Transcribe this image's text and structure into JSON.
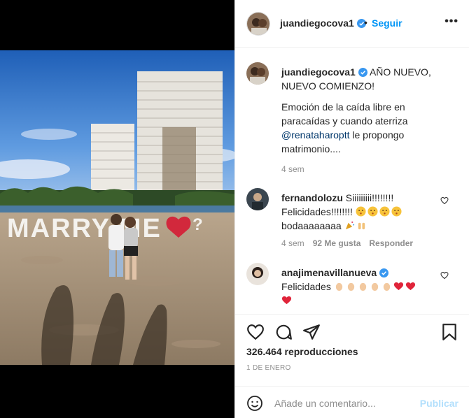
{
  "post": {
    "author": "juandiegocova1",
    "follow_label": "Seguir",
    "separator": "•",
    "more_label": "•••"
  },
  "photo": {
    "sign_text": "MARRY ME",
    "sign_question": "?"
  },
  "caption": {
    "username": "juandiegocova1",
    "headline": "AÑO NUEVO, NUEVO COMIENZO!",
    "body_before": "Emoción de la caída libre en paracaídas y cuando aterriza ",
    "mention": "@renataharoptt",
    "body_after": " le propongo matrimonio....",
    "time": "4 sem"
  },
  "comments": [
    {
      "username": "fernandolozu",
      "text_line1": "Siiiiiiiii!!!!!!!!",
      "text_line2": "Felicidades!!!!!!!!",
      "text_line3": "bodaaaaaaaa",
      "time": "4 sem",
      "likes": "92 Me gusta",
      "reply": "Responder"
    },
    {
      "username": "anajimenavillanueva",
      "text": "Felicidades"
    }
  ],
  "stats": {
    "views": "326.464 reproducciones",
    "date": "1 DE ENERO"
  },
  "composer": {
    "placeholder": "Añade un comentario...",
    "publish_label": "Publicar"
  },
  "colors": {
    "accent": "#0095f6",
    "publish_disabled": "#b2dffc",
    "verified": "#3897f0",
    "muted": "#8e8e8e"
  },
  "icons": [
    "verified-icon",
    "more-options-icon",
    "heart-icon",
    "comment-icon",
    "share-icon",
    "bookmark-icon",
    "emoji-icon"
  ]
}
